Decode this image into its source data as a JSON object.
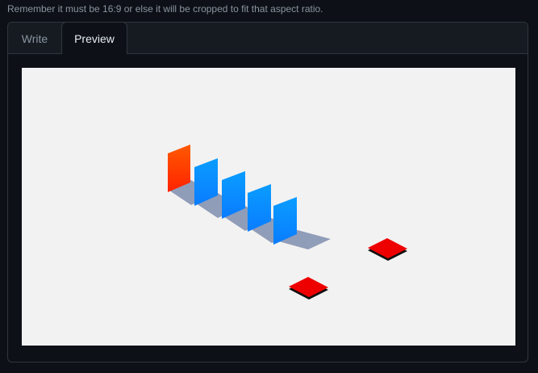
{
  "hint_text": "Remember it must be 16:9 or else it will be cropped to fit that aspect ratio.",
  "tabs": {
    "write_label": "Write",
    "preview_label": "Preview",
    "active": "Preview"
  },
  "scene": {
    "background_color": "#f3f2f2",
    "highlight_panel_color": "#ff4400",
    "panel_color": "#0a8cff",
    "shadow_color": "#7f8fb0",
    "tile_color": "#ee0000",
    "tile_edge_color": "#111111"
  }
}
